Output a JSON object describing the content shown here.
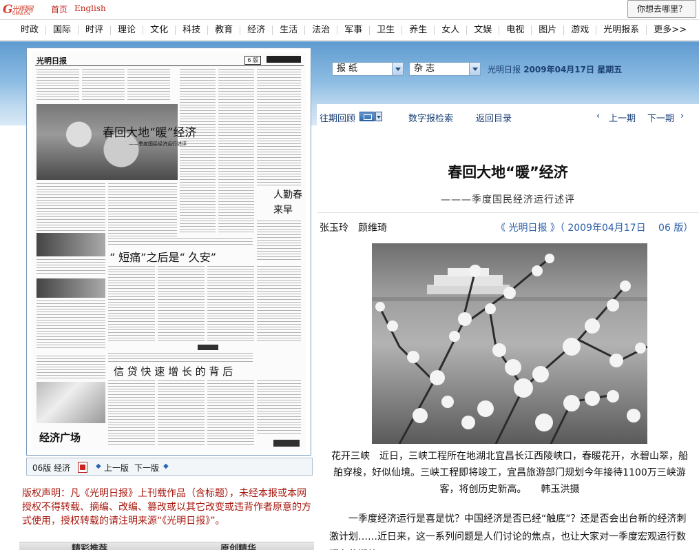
{
  "topbar": {
    "home_label": "首页",
    "english_label": "English",
    "search_button": "你想去哪里？"
  },
  "nav": {
    "items": [
      "时政",
      "国际",
      "时评",
      "理论",
      "文化",
      "科技",
      "教育",
      "经济",
      "生活",
      "法治",
      "军事",
      "卫生",
      "养生",
      "女人",
      "文娱",
      "电视",
      "图片",
      "游戏",
      "光明报系",
      "更多>>"
    ]
  },
  "controls": {
    "newspaper_select": "报 纸",
    "magazine_select": "杂 志",
    "paper_name": "光明日报",
    "date": "2009年04月17日",
    "weekday": "星期五",
    "archive_label": "往期回顾",
    "digital_search": "数字报检索",
    "back_to_toc": "返回目录",
    "prev_article": "上一期",
    "next_article": "下一期",
    "prev_arrow": "‹",
    "next_arrow": "›"
  },
  "page_preview": {
    "masthead": "光明日报",
    "page_tag": "6 版",
    "headline_main": "春回大地“暖”经济",
    "headline_sub": "——季度国民经济运行述评",
    "headline_2": "“ 短痛”之后是“ 久安”",
    "headline_3": "信 贷 快 速 增 长 的 背 后",
    "side_head": "人勤春来早",
    "section_label": "经济广场"
  },
  "page_toolbar": {
    "page_label": "06版 经济",
    "prev_page": "上一版",
    "next_page": "下一版"
  },
  "copyright": "版权声明：凡《光明日报》上刊载作品（含标题），未经本报或本网授权不得转载、摘编、改编、篡改或以其它改变或违背作者原意的方式使用，授权转载的请注明来源“《光明日报》”。",
  "bottom_tabs": [
    "精彩推荐",
    "原创精华"
  ],
  "article": {
    "title": "春回大地“暖”经济",
    "subtitle": "———季度国民经济运行述评",
    "authors": "张玉玲　颜维琦",
    "source": "《 光明日报 》（ 2009年04月17日　 06 版）",
    "caption": "花开三峡　近日，三峡工程所在地湖北宜昌长江西陵峡口，春暖花开，水碧山翠，船舶穿梭，好似仙境。三峡工程即将竣工，宜昌旅游部门规划今年接待1100万三峡游客，将创历史新高。　　韩玉洪摄",
    "body": "一季度经济运行是喜是忧？中国经济是否已经“触底”？还是否会出台新的经济刺激计划……近日来，这一系列问题是人们讨论的焦点，也让大家对一季度宏观运行数据有些期待。"
  },
  "colors": {
    "brand_red": "#c0261c",
    "link_blue": "#2a5ea8",
    "band_blue": "#5f9bd1"
  }
}
